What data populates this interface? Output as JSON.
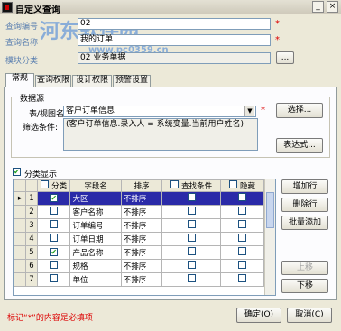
{
  "window": {
    "title": "自定义查询",
    "min": "_",
    "close": "×"
  },
  "watermark": {
    "line1": "河东软件园",
    "line2": "www.pc0359.cn"
  },
  "header": {
    "code_label": "查询编号",
    "code_value": "02",
    "name_label": "查询名称",
    "name_value": "我的订单",
    "module_label": "模块分类",
    "module_value": "02 业务单据",
    "browse": "..."
  },
  "tabs": [
    "常规",
    "查询权限",
    "设计权限",
    "预警设置"
  ],
  "datasource": {
    "group_title": "数据源",
    "table_label": "表/视图名:",
    "table_value": "客户订单信息",
    "select_btn": "选择...",
    "filter_label": "筛选条件:",
    "filter_value": "(客户订单信息.录入人 = 系统变量.当前用户姓名)",
    "expr_btn": "表达式..."
  },
  "classify": {
    "label": "分类显示",
    "checked": true
  },
  "grid": {
    "headers": {
      "classify": "分类",
      "field": "字段名",
      "sort": "排序",
      "query": "查找条件",
      "hidden": "隐藏"
    },
    "rows": [
      {
        "no": "1",
        "marker": "▸",
        "classify": true,
        "field": "大区",
        "sort": "不排序",
        "query": false,
        "hidden": false,
        "selected": true
      },
      {
        "no": "2",
        "marker": "",
        "classify": false,
        "field": "客户名称",
        "sort": "不排序",
        "query": false,
        "hidden": false,
        "selected": false
      },
      {
        "no": "3",
        "marker": "",
        "classify": false,
        "field": "订单编号",
        "sort": "不排序",
        "query": false,
        "hidden": false,
        "selected": false
      },
      {
        "no": "4",
        "marker": "",
        "classify": false,
        "field": "订单日期",
        "sort": "不排序",
        "query": false,
        "hidden": false,
        "selected": false
      },
      {
        "no": "5",
        "marker": "",
        "classify": true,
        "field": "产品名称",
        "sort": "不排序",
        "query": false,
        "hidden": false,
        "selected": false
      },
      {
        "no": "6",
        "marker": "",
        "classify": false,
        "field": "规格",
        "sort": "不排序",
        "query": false,
        "hidden": false,
        "selected": false
      },
      {
        "no": "7",
        "marker": "",
        "classify": false,
        "field": "单位",
        "sort": "不排序",
        "query": false,
        "hidden": false,
        "selected": false
      }
    ]
  },
  "side_buttons": {
    "add": "增加行",
    "delete": "删除行",
    "batch": "批量添加",
    "up": "上移",
    "down": "下移"
  },
  "footer": {
    "note": "标记“*”的内容是必填项",
    "ok": "确定(O)",
    "cancel": "取消(C)"
  },
  "colors": {
    "required": "#dd0000",
    "selection": "#2a2aa8"
  }
}
